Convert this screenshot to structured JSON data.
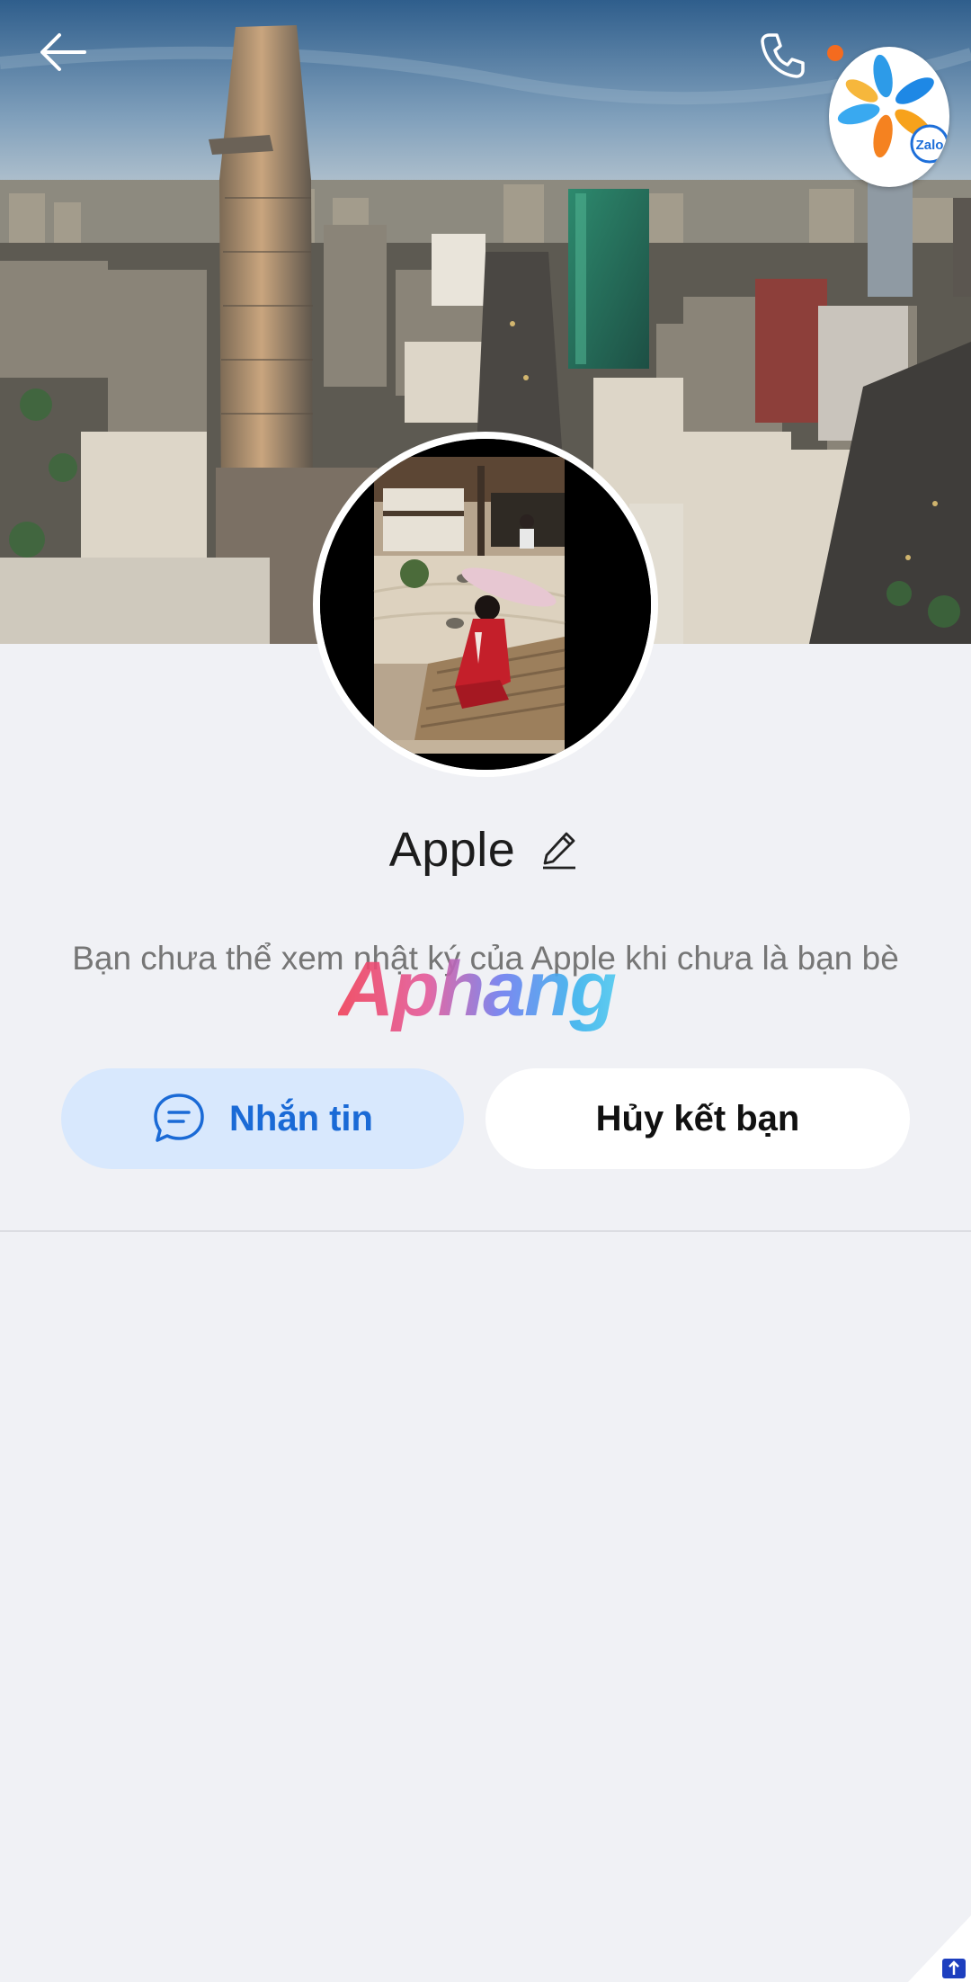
{
  "header": {
    "back_icon": "arrow-left-icon",
    "call_icon": "phone-icon",
    "brand_logo": "zalo-logo",
    "brand_logo_text": "Zalo"
  },
  "profile": {
    "name": "Apple",
    "edit_icon": "pencil-icon",
    "notice": "Bạn chưa thể xem nhật ký của Apple khi chưa là bạn bè"
  },
  "actions": {
    "message_label": "Nhắn tin",
    "message_icon": "chat-bubble-icon",
    "unfriend_label": "Hủy kết bạn"
  },
  "watermark": {
    "text": "Aphang"
  },
  "colors": {
    "accent": "#1a6ad6",
    "message_bg": "#d8e8fd",
    "notification_dot": "#f46b1f",
    "background": "#f0f1f5"
  }
}
